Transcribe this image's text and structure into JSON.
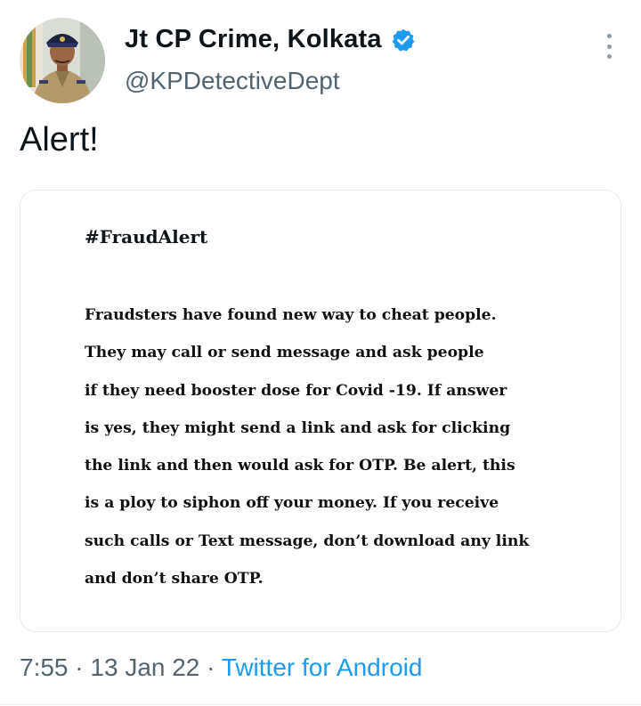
{
  "author": {
    "display_name": "Jt CP Crime, Kolkata",
    "handle": "@KPDetectiveDept",
    "verified_icon": "verified-badge-icon"
  },
  "tweet": {
    "text": "Alert!",
    "time": "7:55",
    "separator": "·",
    "date": "13 Jan 22",
    "source": "Twitter for Android"
  },
  "media": {
    "title": "#FraudAlert",
    "lines": [
      "Fraudsters have found new way to cheat people.",
      "They may call or send message and ask people",
      "if they need booster dose for Covid -19. If answer",
      "is yes, they might send a link and ask for clicking",
      "the link and then would ask for OTP. Be alert, this",
      "is a ploy to siphon off your money. If you receive",
      "such calls or Text message, don’t download any link",
      "and don’t share OTP."
    ]
  },
  "colors": {
    "verified": "#1d9bf0",
    "link": "#1d9bf0",
    "secondary_text": "#536471"
  }
}
